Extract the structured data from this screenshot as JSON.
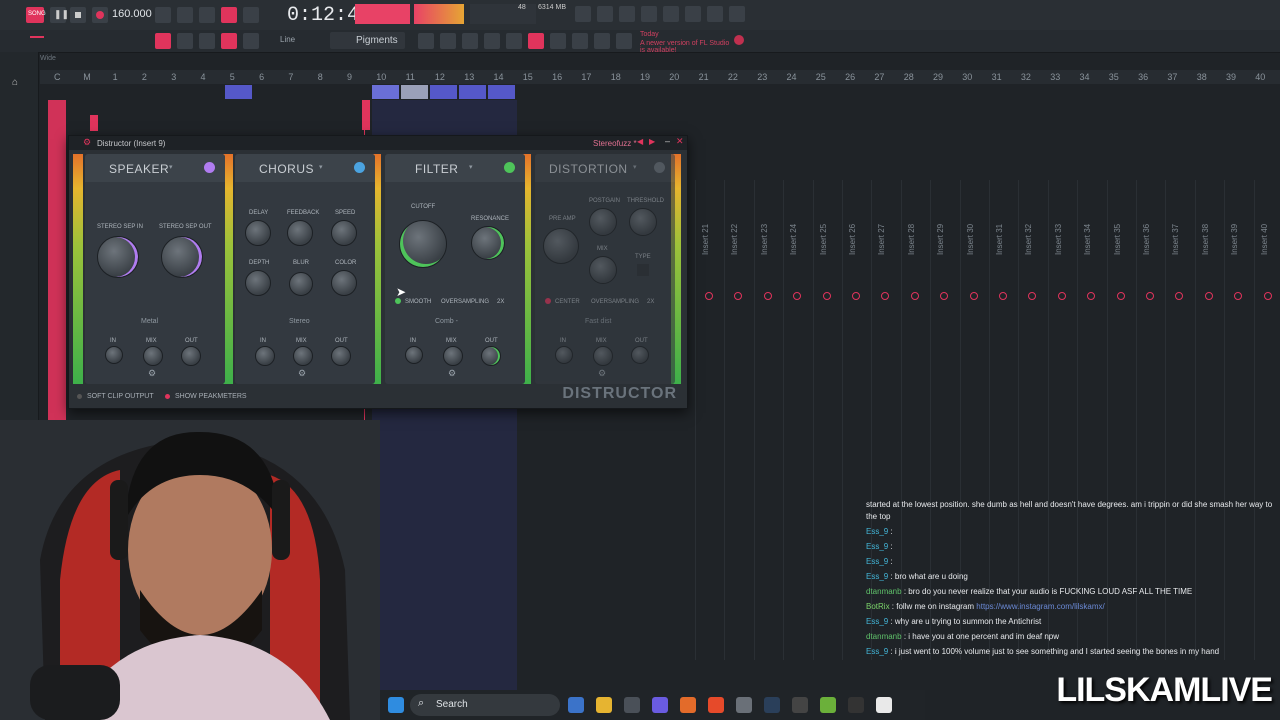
{
  "toolbar": {
    "time": "0:12:48",
    "tempo": "160.000",
    "song_mode": "SONG",
    "cpu": "48",
    "mem": "6314 MB",
    "brush": "Line",
    "pattern": "Pigments",
    "news_prefix": "Today",
    "news_text": "A newer version of FL Studio is available!"
  },
  "playlist": {
    "ruler": [
      "C",
      "M",
      "1",
      "2",
      "3",
      "4",
      "5",
      "6",
      "7",
      "8",
      "9",
      "10",
      "11",
      "12",
      "13",
      "14",
      "15",
      "16",
      "17",
      "18",
      "19",
      "20",
      "21",
      "22",
      "23",
      "24",
      "25",
      "26",
      "27",
      "28",
      "29",
      "30",
      "31",
      "32",
      "33",
      "34",
      "35",
      "36",
      "37",
      "38",
      "39",
      "40"
    ],
    "tool_label": "Wide"
  },
  "mixer": {
    "inserts": [
      "Insert 21",
      "Insert 22",
      "Insert 23",
      "Insert 24",
      "Insert 25",
      "Insert 26",
      "Insert 27",
      "Insert 28",
      "Insert 29",
      "Insert 30",
      "Insert 31",
      "Insert 32",
      "Insert 33",
      "Insert 34",
      "Insert 35",
      "Insert 36",
      "Insert 37",
      "Insert 38",
      "Insert 39",
      "Insert 40"
    ]
  },
  "plugin": {
    "title": "Distructor (Insert 9)",
    "preset": "Stereofuzz *",
    "brand": "DISTRUCTOR",
    "soft_clip": "SOFT CLIP OUTPUT",
    "show_peak": "SHOW PEAKMETERS",
    "in_label": "IN",
    "mix_label": "MIX",
    "out_label": "OUT",
    "modules": {
      "speaker": {
        "title": "SPEAKER",
        "k1": "STEREO SEP IN",
        "k2": "STEREO SEP OUT",
        "mode": "Metal"
      },
      "chorus": {
        "title": "CHORUS",
        "k1": "DELAY",
        "k2": "FEEDBACK",
        "k3": "SPEED",
        "k4": "DEPTH",
        "k5": "BLUR",
        "k6": "COLOR",
        "mode": "Stereo"
      },
      "filter": {
        "title": "FILTER",
        "k1": "CUTOFF",
        "k2": "RESONANCE",
        "smooth": "SMOOTH",
        "oversampling": "OVERSAMPLING",
        "os_value": "2x",
        "mode": "Comb -"
      },
      "distortion": {
        "title": "DISTORTION",
        "k1": "PRE AMP",
        "k2": "POSTGAIN",
        "k3": "THRESHOLD",
        "k4": "MIX",
        "k5": "TYPE",
        "center": "CENTER",
        "oversampling": "OVERSAMPLING",
        "os_value": "2x",
        "mode": "Fast dist"
      }
    }
  },
  "chat": {
    "header": "started at the lowest position. she dumb as hell and doesn't have degrees. am i trippin or did she smash her way to",
    "header2": "the top",
    "lines": [
      {
        "name": "Ess_9",
        "text": ""
      },
      {
        "name": "Ess_9",
        "text": ""
      },
      {
        "name": "Ess_9",
        "text": ""
      },
      {
        "name": "Ess_9",
        "text": "bro what are u doing"
      },
      {
        "name": "dtanmanb",
        "text": "bro do you never realize that your audio is FUCKING LOUD ASF ALL THE TIME"
      },
      {
        "name": "BotRix",
        "text": "follw me on instagram ",
        "link": "https://www.instagram.com/lilskamx/"
      },
      {
        "name": "Ess_9",
        "text": "why are u trying to summon the Antichrist"
      },
      {
        "name": "dtanmanb",
        "text": "i have you at one percent and im deaf npw"
      },
      {
        "name": "Ess_9",
        "text": "i just went to 100% volume just to see something and I started seeing the bones in my hand"
      }
    ]
  },
  "taskbar": {
    "search": "Search"
  },
  "watermark": "LILSKAMLIVE",
  "colors": {
    "accent": "#e0345c",
    "meter_green": "#3eb04a",
    "chat_name": "#43b6d8"
  }
}
